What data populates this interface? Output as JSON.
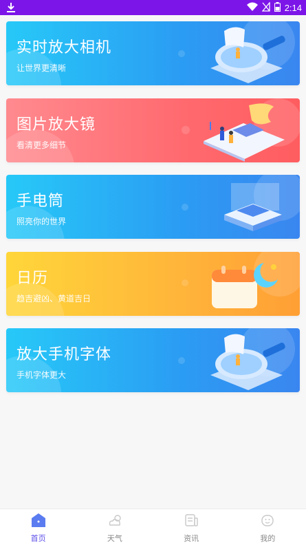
{
  "status_bar": {
    "time": "2:14"
  },
  "cards": [
    {
      "title": "实时放大相机",
      "subtitle": "让世界更清晰"
    },
    {
      "title": "图片放大镜",
      "subtitle": "看清更多细节"
    },
    {
      "title": "手电筒",
      "subtitle": "照亮你的世界"
    },
    {
      "title": "日历",
      "subtitle": "趋吉避凶、黄道吉日"
    },
    {
      "title": "放大手机字体",
      "subtitle": "手机字体更大"
    }
  ],
  "tabs": [
    {
      "label": "首页",
      "icon": "home-icon",
      "active": true
    },
    {
      "label": "天气",
      "icon": "weather-icon",
      "active": false
    },
    {
      "label": "资讯",
      "icon": "news-icon",
      "active": false
    },
    {
      "label": "我的",
      "icon": "profile-icon",
      "active": false
    }
  ],
  "colors": {
    "status_bar": "#7c16e8",
    "active_tab": "#5b4de8",
    "blue_card": "#2b9cf3",
    "red_card": "#ff6a6f",
    "orange_card": "#ffb43a"
  }
}
